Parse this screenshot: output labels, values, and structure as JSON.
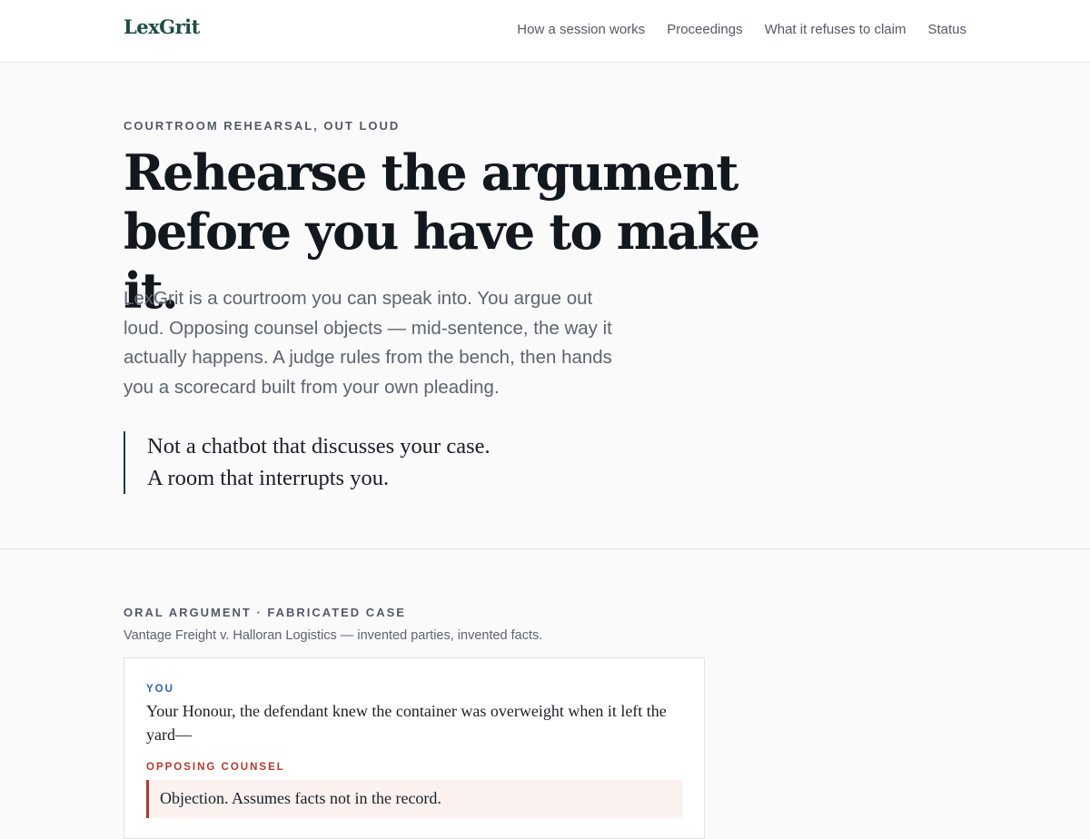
{
  "header": {
    "brand": "LexGrit",
    "nav": [
      {
        "label": "How a session works"
      },
      {
        "label": "Proceedings"
      },
      {
        "label": "What it refuses to claim"
      },
      {
        "label": "Status"
      }
    ]
  },
  "hero": {
    "eyebrow": "COURTROOM REHEARSAL, OUT LOUD",
    "headline_line1": "Rehearse the argument",
    "headline_line2": "before you have to make it.",
    "lede": "LexGrit is a courtroom you can speak into. You argue out loud. Opposing counsel objects — mid-sentence, the way it actually happens. A judge rules from the bench, then hands you a scorecard built from your own pleading.",
    "pullquote": "Not a chatbot that discusses your case. A room that interrupts you."
  },
  "demo": {
    "eyebrow": "ORAL ARGUMENT · FABRICATED CASE",
    "caption": "Vantage Freight v. Halloran Logistics — invented parties, invented facts.",
    "transcript": {
      "you_label": "YOU",
      "you_text": "Your Honour, the defendant knew the container was overweight when it left the yard—",
      "opposing_label": "OPPOSING COUNSEL",
      "opposing_text": "Objection. Assumes facts not in the record."
    }
  },
  "colors": {
    "brand": "#1f4d43",
    "you_accent": "#2f5fb8",
    "opposing_accent": "#b03a2e",
    "objection_bg": "#fbf1ef"
  }
}
